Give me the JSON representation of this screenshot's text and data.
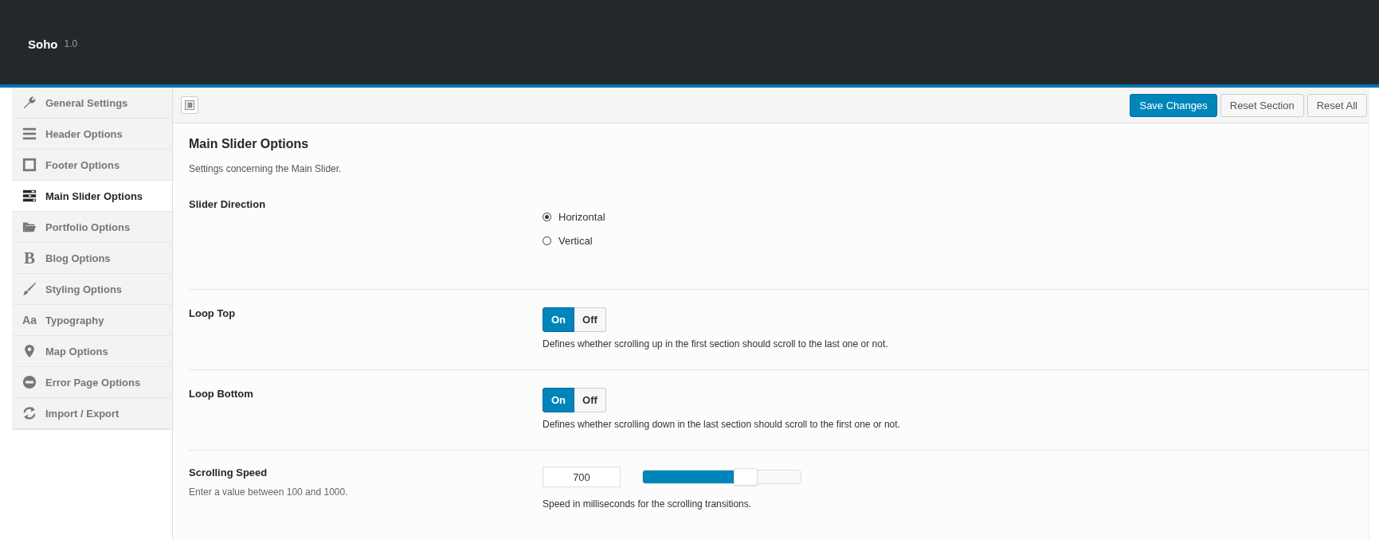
{
  "header": {
    "title": "Soho",
    "version": "1.0"
  },
  "sidebar": {
    "items": [
      {
        "label": "General Settings",
        "selected": false
      },
      {
        "label": "Header Options",
        "selected": false
      },
      {
        "label": "Footer Options",
        "selected": false
      },
      {
        "label": "Main Slider Options",
        "selected": true
      },
      {
        "label": "Portfolio Options",
        "selected": false
      },
      {
        "label": "Blog Options",
        "selected": false,
        "icon_glyph": "B"
      },
      {
        "label": "Styling Options",
        "selected": false
      },
      {
        "label": "Typography",
        "selected": false,
        "icon_glyph": "Aa"
      },
      {
        "label": "Map Options",
        "selected": false
      },
      {
        "label": "Error Page Options",
        "selected": false
      },
      {
        "label": "Import / Export",
        "selected": false
      }
    ]
  },
  "toolbar": {
    "buttons": [
      {
        "label": "Save Changes",
        "kind": "primary"
      },
      {
        "label": "Reset Section",
        "kind": "secondary"
      },
      {
        "label": "Reset All",
        "kind": "secondary"
      }
    ]
  },
  "section": {
    "title": "Main Slider Options",
    "description": "Settings concerning the Main Slider."
  },
  "settings": [
    {
      "kind": "radio",
      "label": "Slider Direction",
      "options": [
        {
          "label": "Horizontal",
          "selected": true
        },
        {
          "label": "Vertical",
          "selected": false
        }
      ]
    },
    {
      "kind": "toggle",
      "label": "Loop Top",
      "buttons": [
        {
          "label": "On",
          "selected": true
        },
        {
          "label": "Off",
          "selected": false
        }
      ],
      "description": "Defines whether scrolling up in the first section should scroll to the last one or not."
    },
    {
      "kind": "toggle",
      "label": "Loop Bottom",
      "buttons": [
        {
          "label": "On",
          "selected": true
        },
        {
          "label": "Off",
          "selected": false
        }
      ],
      "description": "Defines whether scrolling down in the last section should scroll to the first one or not."
    },
    {
      "kind": "slider",
      "label": "Scrolling Speed",
      "hint": "Enter a value between 100 and 1000.",
      "value": "700",
      "level": 0.67,
      "description": "Speed in milliseconds for the scrolling transitions."
    }
  ]
}
